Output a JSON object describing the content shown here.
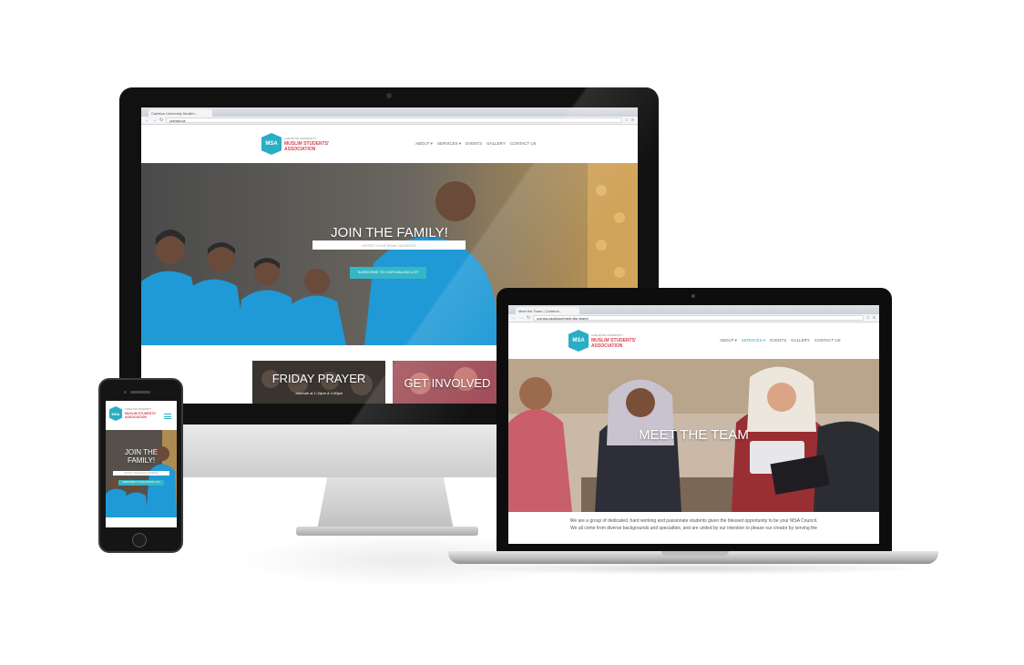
{
  "desktop": {
    "tab_title": "Carleton University Muslim...",
    "url": "cumsa.ca",
    "logo": {
      "badge": "MSA",
      "small": "CARLETON UNIVERSITY",
      "line1": "MUSLIM STUDENTS'",
      "line2": "ASSOCIATION"
    },
    "nav": [
      "ABOUT ▾",
      "SERVICES ▾",
      "EVENTS",
      "GALLERY",
      "CONTACT US"
    ],
    "hero_title": "JOIN THE FAMILY!",
    "email_placeholder": "ENTER YOUR EMAIL ADDRESS",
    "subscribe_label": "SUBSCRIBE TO OUR MAILING LIST",
    "cards": [
      {
        "title": "FRIDAY PRAYER",
        "subtitle": "Jummah at 1:15pm & 1:50pm"
      },
      {
        "title": "GET INVOLVED",
        "subtitle": ""
      }
    ]
  },
  "laptop": {
    "tab_title": "Meet the Team | Carleton...",
    "url": "cumsa.ca/about/meet-the-team/",
    "logo": {
      "badge": "MSA",
      "small": "CARLETON UNIVERSITY",
      "line1": "MUSLIM STUDENTS'",
      "line2": "ASSOCIATION"
    },
    "nav": [
      "ABOUT ▾",
      "SERVICES ▾",
      "EVENTS",
      "GALLERY",
      "CONTACT US"
    ],
    "hero_title": "MEET THE TEAM",
    "intro_line1": "We are a group of dedicated, hard working and passionate students given the blessed opportunity to be your MSA Council.",
    "intro_line2": "We all come from diverse backgrounds and specialties, and are united by our intention to please our creator by serving the"
  },
  "phone": {
    "logo": {
      "badge": "MSA",
      "small": "CARLETON UNIVERSITY",
      "line1": "MUSLIM STUDENTS'",
      "line2": "ASSOCIATION"
    },
    "hero_title": "JOIN THE FAMILY!",
    "email_placeholder": "ENTER YOUR EMAIL ADDRESS",
    "subscribe_label": "SUBSCRIBE TO OUR MAILING LIST"
  },
  "colors": {
    "accent": "#2aaec5",
    "logo_red": "#d9434f",
    "hero_blue": "#1b9ad6"
  },
  "icons": [
    "back-arrow-icon",
    "forward-arrow-icon",
    "reload-icon",
    "menu-icon",
    "star-icon"
  ]
}
